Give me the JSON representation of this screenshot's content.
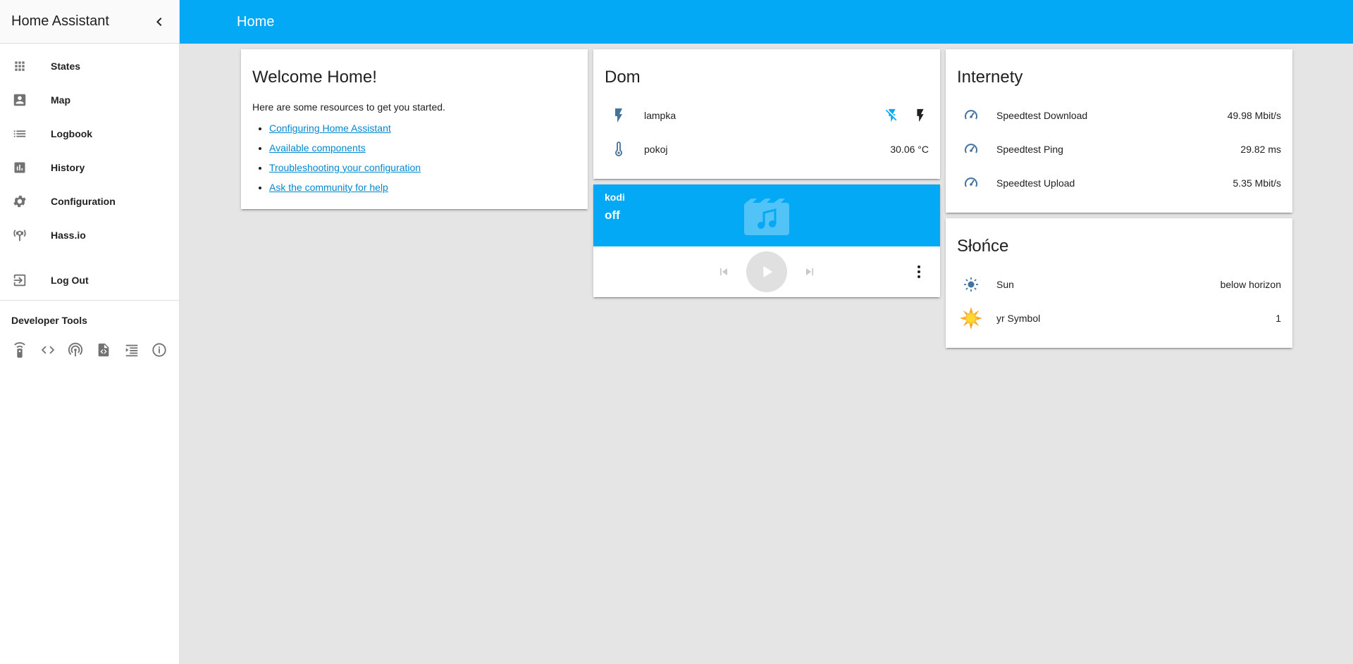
{
  "sidebar": {
    "title": "Home Assistant",
    "items": [
      {
        "label": "States",
        "icon": "apps-icon"
      },
      {
        "label": "Map",
        "icon": "account-box-icon"
      },
      {
        "label": "Logbook",
        "icon": "list-icon"
      },
      {
        "label": "History",
        "icon": "chart-icon"
      },
      {
        "label": "Configuration",
        "icon": "gear-icon"
      },
      {
        "label": "Hass.io",
        "icon": "hassio-icon"
      }
    ],
    "logout_label": "Log Out",
    "developer_tools_title": "Developer Tools",
    "developer_tools": [
      "remote-icon",
      "code-icon",
      "broadcast-icon",
      "template-icon",
      "mqtt-icon",
      "info-icon"
    ]
  },
  "header": {
    "title": "Home"
  },
  "welcome": {
    "title": "Welcome Home!",
    "intro": "Here are some resources to get you started.",
    "links": [
      "Configuring Home Assistant",
      "Available components",
      "Troubleshooting your configuration",
      "Ask the community for help"
    ]
  },
  "dom": {
    "title": "Dom",
    "rows": [
      {
        "name": "lampka",
        "icon": "flash-icon"
      },
      {
        "name": "pokoj",
        "icon": "thermometer-icon",
        "value": "30.06 °C"
      }
    ]
  },
  "kodi": {
    "name": "kodi",
    "state": "off"
  },
  "internety": {
    "title": "Internety",
    "rows": [
      {
        "name": "Speedtest Download",
        "value": "49.98 Mbit/s"
      },
      {
        "name": "Speedtest Ping",
        "value": "29.82 ms"
      },
      {
        "name": "Speedtest Upload",
        "value": "5.35 Mbit/s"
      }
    ]
  },
  "slonce": {
    "title": "Słońce",
    "rows": [
      {
        "name": "Sun",
        "value": "below horizon",
        "icon": "sun-icon"
      },
      {
        "name": "yr Symbol",
        "value": "1",
        "icon": "sunny-icon"
      }
    ]
  },
  "colors": {
    "accent": "#03a9f4",
    "icon": "#44739e",
    "link": "#0288d1",
    "background": "#e5e5e5"
  }
}
